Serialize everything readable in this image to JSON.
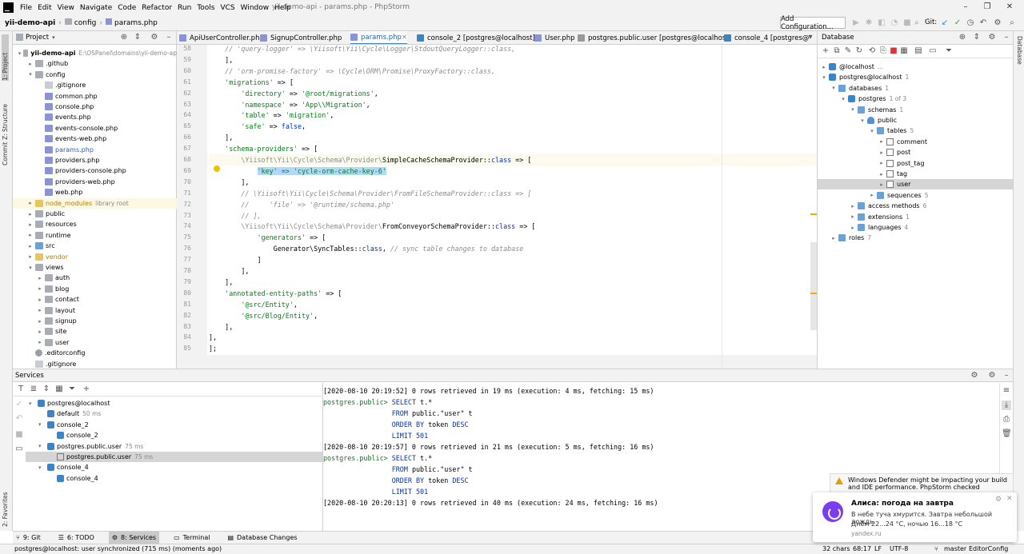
{
  "window": {
    "title": "yii-demo-api - params.php - PhpStorm"
  },
  "menu": [
    "File",
    "Edit",
    "View",
    "Navigate",
    "Code",
    "Refactor",
    "Run",
    "Tools",
    "VCS",
    "Window",
    "Help"
  ],
  "menu_mnemonics": [
    "F",
    "E",
    "V",
    "N",
    "C",
    "R",
    "R",
    "T",
    "S",
    "W",
    "H"
  ],
  "breadcrumbs": [
    "yii-demo-api",
    "config",
    "params.php"
  ],
  "toolbar": {
    "add_config": "Add Configuration...",
    "git_label": "Git:"
  },
  "left_strip": {
    "project": "1: Project",
    "structure": "Z: Structure",
    "commit": "Commit",
    "favorites": "2: Favorites"
  },
  "right_strip": {
    "database": "Database"
  },
  "project": {
    "title": "Project",
    "tree": [
      {
        "label": "yii-demo-api",
        "hint": "E:\\OSPanel\\domains\\yii-demo-ap",
        "indent": 0,
        "arrow": "▾",
        "type": "folder",
        "bold": true
      },
      {
        "label": ".github",
        "indent": 1,
        "arrow": "▸",
        "type": "folder"
      },
      {
        "label": "config",
        "indent": 1,
        "arrow": "▾",
        "type": "folder"
      },
      {
        "label": ".gitignore",
        "indent": 2,
        "type": "txt"
      },
      {
        "label": "common.php",
        "indent": 2,
        "type": "php"
      },
      {
        "label": "console.php",
        "indent": 2,
        "type": "php"
      },
      {
        "label": "events.php",
        "indent": 2,
        "type": "php"
      },
      {
        "label": "events-console.php",
        "indent": 2,
        "type": "php"
      },
      {
        "label": "events-web.php",
        "indent": 2,
        "type": "php"
      },
      {
        "label": "params.php",
        "indent": 2,
        "type": "php",
        "blue": true
      },
      {
        "label": "providers.php",
        "indent": 2,
        "type": "php"
      },
      {
        "label": "providers-console.php",
        "indent": 2,
        "type": "php"
      },
      {
        "label": "providers-web.php",
        "indent": 2,
        "type": "php"
      },
      {
        "label": "web.php",
        "indent": 2,
        "type": "php"
      },
      {
        "label": "node_modules",
        "hint": "library root",
        "indent": 1,
        "arrow": "▸",
        "type": "folder-yellow",
        "lib": true,
        "color": "#b08000"
      },
      {
        "label": "public",
        "indent": 1,
        "arrow": "▸",
        "type": "folder"
      },
      {
        "label": "resources",
        "indent": 1,
        "arrow": "▸",
        "type": "folder"
      },
      {
        "label": "runtime",
        "indent": 1,
        "arrow": "▸",
        "type": "folder"
      },
      {
        "label": "src",
        "indent": 1,
        "arrow": "▸",
        "type": "folder-blue"
      },
      {
        "label": "vendor",
        "indent": 1,
        "arrow": "▸",
        "type": "folder-yellow",
        "color": "#b08000"
      },
      {
        "label": "views",
        "indent": 1,
        "arrow": "▾",
        "type": "folder"
      },
      {
        "label": "auth",
        "indent": 2,
        "arrow": "▸",
        "type": "folder"
      },
      {
        "label": "blog",
        "indent": 2,
        "arrow": "▸",
        "type": "folder"
      },
      {
        "label": "contact",
        "indent": 2,
        "arrow": "▸",
        "type": "folder"
      },
      {
        "label": "layout",
        "indent": 2,
        "arrow": "▸",
        "type": "folder"
      },
      {
        "label": "signup",
        "indent": 2,
        "arrow": "▸",
        "type": "folder"
      },
      {
        "label": "site",
        "indent": 2,
        "arrow": "▸",
        "type": "folder"
      },
      {
        "label": "user",
        "indent": 2,
        "arrow": "▸",
        "type": "folder"
      },
      {
        "label": ".editorconfig",
        "indent": 1,
        "type": "cfg"
      },
      {
        "label": ".gitignore",
        "indent": 1,
        "type": "txt"
      }
    ]
  },
  "editor": {
    "tabs": [
      {
        "label": "ApiUserController.php",
        "color": "#8a93d8"
      },
      {
        "label": "SignupController.php",
        "color": "#8a93d8"
      },
      {
        "label": "params.php",
        "color": "#8a93d8",
        "active": true
      },
      {
        "label": "console_2 [postgres@localhost]",
        "color": "#3a84c8"
      },
      {
        "label": "User.php",
        "color": "#8a93d8"
      },
      {
        "label": "postgres.public.user [postgres@localhost]",
        "color": "#999"
      },
      {
        "label": "console_4 [postgres@",
        "color": "#3a84c8"
      }
    ],
    "first_line": 58,
    "lines": [
      [
        {
          "t": "    ",
          "c": ""
        },
        {
          "t": "// 'query-logger' => \\Yiisoft\\Yii\\Cycle\\Logger\\StdoutQueryLogger::class,",
          "c": "cm"
        }
      ],
      [
        {
          "t": "    ],",
          "c": ""
        }
      ],
      [
        {
          "t": "    ",
          "c": ""
        },
        {
          "t": "// 'orm-promise-factory' => \\Cycle\\ORM\\Promise\\ProxyFactory::class,",
          "c": "cm"
        }
      ],
      [
        {
          "t": "    ",
          "c": ""
        },
        {
          "t": "'migrations'",
          "c": "s"
        },
        {
          "t": " => [",
          "c": ""
        }
      ],
      [
        {
          "t": "        ",
          "c": ""
        },
        {
          "t": "'directory'",
          "c": "s"
        },
        {
          "t": " => ",
          "c": ""
        },
        {
          "t": "'@root/migrations'",
          "c": "s"
        },
        {
          "t": ",",
          "c": ""
        }
      ],
      [
        {
          "t": "        ",
          "c": ""
        },
        {
          "t": "'namespace'",
          "c": "s"
        },
        {
          "t": " => ",
          "c": ""
        },
        {
          "t": "'App\\\\Migration'",
          "c": "s"
        },
        {
          "t": ",",
          "c": ""
        }
      ],
      [
        {
          "t": "        ",
          "c": ""
        },
        {
          "t": "'table'",
          "c": "s"
        },
        {
          "t": " => ",
          "c": ""
        },
        {
          "t": "'migration'",
          "c": "s"
        },
        {
          "t": ",",
          "c": ""
        }
      ],
      [
        {
          "t": "        ",
          "c": ""
        },
        {
          "t": "'safe'",
          "c": "s"
        },
        {
          "t": " => ",
          "c": ""
        },
        {
          "t": "false",
          "c": "k"
        },
        {
          "t": ",",
          "c": ""
        }
      ],
      [
        {
          "t": "    ],",
          "c": ""
        }
      ],
      [
        {
          "t": "    ",
          "c": ""
        },
        {
          "t": "'schema-providers'",
          "c": "s"
        },
        {
          "t": " => [",
          "c": ""
        }
      ],
      [
        {
          "t": "        ",
          "c": ""
        },
        {
          "t": "\\Yiisoft\\Yii\\Cycle\\Schema\\Provider\\",
          "c": "dim"
        },
        {
          "t": "SimpleCacheSchemaProvider::",
          "c": ""
        },
        {
          "t": "class",
          "c": "k"
        },
        {
          "t": " => [",
          "c": ""
        }
      ],
      [
        {
          "t": "            ",
          "c": ""
        },
        {
          "t": "'key' => 'cycle-orm-cache-key-6'",
          "c": "s hl"
        }
      ],
      [
        {
          "t": "        ],",
          "c": ""
        }
      ],
      [
        {
          "t": "        ",
          "c": ""
        },
        {
          "t": "// \\Yiisoft\\Yii\\Cycle\\Schema\\Provider\\FromFileSchemaProvider::class => [",
          "c": "cm"
        }
      ],
      [
        {
          "t": "        ",
          "c": ""
        },
        {
          "t": "//     'file' => '@runtime/schema.php'",
          "c": "cm"
        }
      ],
      [
        {
          "t": "        ",
          "c": ""
        },
        {
          "t": "// ],",
          "c": "cm"
        }
      ],
      [
        {
          "t": "        ",
          "c": ""
        },
        {
          "t": "\\Yiisoft\\Yii\\Cycle\\Schema\\Provider\\",
          "c": "dim"
        },
        {
          "t": "FromConveyorSchemaProvider::",
          "c": ""
        },
        {
          "t": "class",
          "c": "k"
        },
        {
          "t": " => [",
          "c": ""
        }
      ],
      [
        {
          "t": "            ",
          "c": ""
        },
        {
          "t": "'generators'",
          "c": "s"
        },
        {
          "t": " => [",
          "c": ""
        }
      ],
      [
        {
          "t": "                Generator\\SyncTables::",
          "c": ""
        },
        {
          "t": "class",
          "c": "k"
        },
        {
          "t": ", ",
          "c": ""
        },
        {
          "t": "// sync table changes to database",
          "c": "cm"
        }
      ],
      [
        {
          "t": "            ]",
          "c": ""
        }
      ],
      [
        {
          "t": "        ],",
          "c": ""
        }
      ],
      [
        {
          "t": "    ],",
          "c": ""
        }
      ],
      [
        {
          "t": "    ",
          "c": ""
        },
        {
          "t": "'annotated-entity-paths'",
          "c": "s"
        },
        {
          "t": " => [",
          "c": ""
        }
      ],
      [
        {
          "t": "        ",
          "c": ""
        },
        {
          "t": "'@src/Entity'",
          "c": "s"
        },
        {
          "t": ",",
          "c": ""
        }
      ],
      [
        {
          "t": "        ",
          "c": ""
        },
        {
          "t": "'@src/Blog/Entity'",
          "c": "s"
        },
        {
          "t": ",",
          "c": ""
        }
      ],
      [
        {
          "t": "    ],",
          "c": ""
        }
      ],
      [
        {
          "t": "],",
          "c": ""
        }
      ],
      [
        {
          "t": "];",
          "c": ""
        }
      ]
    ],
    "current_line": 68
  },
  "database": {
    "title": "Database",
    "tree": [
      {
        "label": "@localhost",
        "cnt": "...",
        "indent": 0,
        "arrow": "▸",
        "type": "ds"
      },
      {
        "label": "postgres@localhost",
        "cnt": "1",
        "indent": 0,
        "arrow": "▾",
        "type": "ds"
      },
      {
        "label": "databases",
        "cnt": "1",
        "indent": 1,
        "arrow": "▾",
        "type": "folder"
      },
      {
        "label": "postgres",
        "cnt": "1 of 3",
        "indent": 2,
        "arrow": "▾",
        "type": "db"
      },
      {
        "label": "schemas",
        "cnt": "1",
        "indent": 3,
        "arrow": "▾",
        "type": "folder"
      },
      {
        "label": "public",
        "indent": 4,
        "arrow": "▾",
        "type": "sch"
      },
      {
        "label": "tables",
        "cnt": "5",
        "indent": 5,
        "arrow": "▾",
        "type": "folder"
      },
      {
        "label": "comment",
        "indent": 6,
        "arrow": "▸",
        "type": "tbl"
      },
      {
        "label": "post",
        "indent": 6,
        "arrow": "▸",
        "type": "tbl"
      },
      {
        "label": "post_tag",
        "indent": 6,
        "arrow": "▸",
        "type": "tbl"
      },
      {
        "label": "tag",
        "indent": 6,
        "arrow": "▸",
        "type": "tbl"
      },
      {
        "label": "user",
        "indent": 6,
        "arrow": "▸",
        "type": "tbl",
        "sel": true
      },
      {
        "label": "sequences",
        "cnt": "5",
        "indent": 5,
        "arrow": "▸",
        "type": "folder"
      },
      {
        "label": "access methods",
        "cnt": "6",
        "indent": 3,
        "arrow": "▸",
        "type": "folder"
      },
      {
        "label": "extensions",
        "cnt": "1",
        "indent": 3,
        "arrow": "▸",
        "type": "folder"
      },
      {
        "label": "languages",
        "cnt": "4",
        "indent": 3,
        "arrow": "▸",
        "type": "folder"
      },
      {
        "label": "roles",
        "cnt": "7",
        "indent": 1,
        "arrow": "▸",
        "type": "folder"
      }
    ]
  },
  "services": {
    "title": "Services",
    "tree": [
      {
        "label": "postgres@localhost",
        "indent": 0,
        "arrow": "▾",
        "type": "ds"
      },
      {
        "label": "default",
        "hint": "50 ms",
        "indent": 1,
        "type": "ds"
      },
      {
        "label": "console_2",
        "indent": 1,
        "arrow": "▾",
        "type": "ds"
      },
      {
        "label": "console_2",
        "indent": 2,
        "type": "ds"
      },
      {
        "label": "postgres.public.user",
        "hint": "75 ms",
        "indent": 1,
        "arrow": "▾",
        "type": "ds"
      },
      {
        "label": "postgres.public.user",
        "hint": "75 ms",
        "indent": 2,
        "type": "tbl",
        "sel": true
      },
      {
        "label": "console_4",
        "indent": 1,
        "arrow": "▾",
        "type": "ds"
      },
      {
        "label": "console_4",
        "indent": 2,
        "type": "ds"
      }
    ],
    "console": [
      {
        "kind": "log",
        "text": "[2020-08-10 20:19:52] 0 rows retrieved in 19 ms (execution: 4 ms, fetching: 15 ms)"
      },
      {
        "kind": "sql",
        "prompt": "postgres.public>",
        "parts": [
          {
            "t": " SELECT ",
            "k": true
          },
          {
            "t": "t.*"
          }
        ]
      },
      {
        "kind": "sql",
        "prompt": "",
        "parts": [
          {
            "t": "                 FROM ",
            "k": true
          },
          {
            "t": "public.\"user\" t"
          }
        ]
      },
      {
        "kind": "sql",
        "prompt": "",
        "parts": [
          {
            "t": "                 ORDER BY ",
            "k": true
          },
          {
            "t": "token "
          },
          {
            "t": "DESC",
            "k": true
          }
        ]
      },
      {
        "kind": "sql",
        "prompt": "",
        "parts": [
          {
            "t": "                 LIMIT ",
            "k": true
          },
          {
            "t": "501",
            "k": true
          }
        ]
      },
      {
        "kind": "log",
        "text": "[2020-08-10 20:19:57] 0 rows retrieved in 21 ms (execution: 5 ms, fetching: 16 ms)"
      },
      {
        "kind": "sql",
        "prompt": "postgres.public>",
        "parts": [
          {
            "t": " SELECT ",
            "k": true
          },
          {
            "t": "t.*"
          }
        ]
      },
      {
        "kind": "sql",
        "prompt": "",
        "parts": [
          {
            "t": "                 FROM ",
            "k": true
          },
          {
            "t": "public.\"user\" t"
          }
        ]
      },
      {
        "kind": "sql",
        "prompt": "",
        "parts": [
          {
            "t": "                 ORDER BY ",
            "k": true
          },
          {
            "t": "token "
          },
          {
            "t": "DESC",
            "k": true
          }
        ]
      },
      {
        "kind": "sql",
        "prompt": "",
        "parts": [
          {
            "t": "                 LIMIT ",
            "k": true
          },
          {
            "t": "501",
            "k": true
          }
        ]
      },
      {
        "kind": "log",
        "text": "[2020-08-10 20:20:13] 0 rows retrieved in 40 ms (execution: 24 ms, fetching: 16 ms)"
      }
    ]
  },
  "bottom_tabs": [
    {
      "label": "9: Git",
      "icon": "⑂"
    },
    {
      "label": "6: TODO",
      "icon": "☰"
    },
    {
      "label": "8: Services",
      "icon": "⚙",
      "active": true
    },
    {
      "label": "Terminal",
      "icon": "▭"
    },
    {
      "label": "Database Changes",
      "icon": "▤"
    }
  ],
  "status": {
    "message": "postgres@localhost: user synchronized (715 ms) (moments ago)",
    "chars": "32 chars",
    "position": "68:17",
    "line_sep": "LF",
    "encoding": "UTF-8",
    "branch": "master",
    "editorconfig": "EditorConfig"
  },
  "notifications": {
    "defender": "Windows Defender might be impacting your build and IDE performance. PhpStorm checked",
    "alice_title": "Алиса: погода на завтра",
    "alice_line1": "В небе туча хмурится. Завтра небольшой дождь.",
    "alice_line2": "Днём 22...24 °C, ночью 16...18 °C",
    "alice_source": "yandex.ru"
  }
}
